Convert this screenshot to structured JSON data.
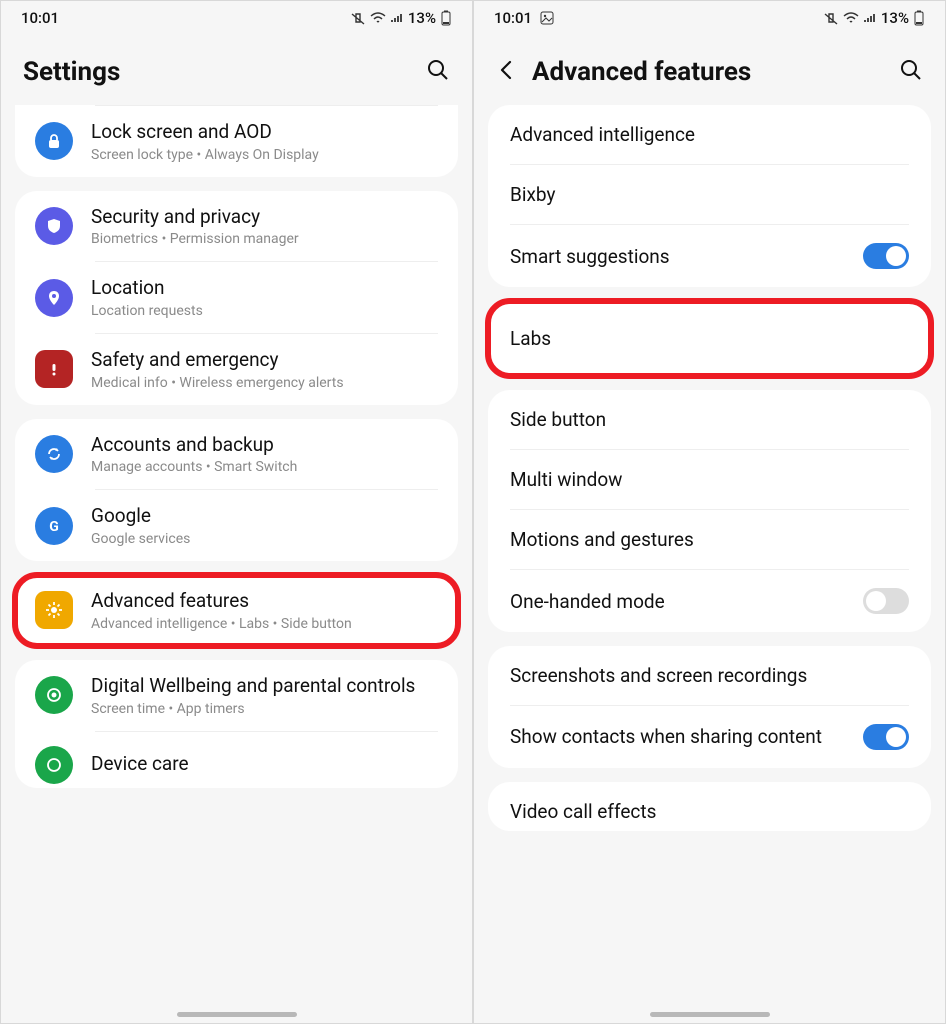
{
  "status": {
    "time": "10:01",
    "battery": "13%",
    "time_right": "10:01"
  },
  "left": {
    "title": "Settings",
    "groups": [
      {
        "items": [
          {
            "title": "Lock screen and AOD",
            "sub": "Screen lock type  •  Always On Display",
            "icon": "lock",
            "iconBg": "#2a7de1"
          }
        ]
      },
      {
        "items": [
          {
            "title": "Security and privacy",
            "sub": "Biometrics  •  Permission manager",
            "icon": "shield",
            "iconBg": "#5b5be6"
          },
          {
            "title": "Location",
            "sub": "Location requests",
            "icon": "pin",
            "iconBg": "#5b5be6"
          },
          {
            "title": "Safety and emergency",
            "sub": "Medical info  •  Wireless emergency alerts",
            "icon": "alert",
            "iconBg": "#b42424"
          }
        ]
      },
      {
        "items": [
          {
            "title": "Accounts and backup",
            "sub": "Manage accounts  •  Smart Switch",
            "icon": "sync",
            "iconBg": "#2a7de1"
          },
          {
            "title": "Google",
            "sub": "Google services",
            "icon": "google",
            "iconBg": "#2a7de1"
          }
        ]
      },
      {
        "items": [
          {
            "title": "Advanced features",
            "sub": "Advanced intelligence  •  Labs  •  Side button",
            "icon": "gear",
            "iconBg": "#f0a800",
            "highlight": true
          }
        ]
      },
      {
        "items": [
          {
            "title": "Digital Wellbeing and parental controls",
            "sub": "Screen time  •  App timers",
            "icon": "wellbeing",
            "iconBg": "#1aa64a"
          },
          {
            "title": "Device care",
            "sub": "",
            "icon": "care",
            "iconBg": "#1aa64a"
          }
        ]
      }
    ]
  },
  "right": {
    "title": "Advanced features",
    "groups": [
      [
        {
          "label": "Advanced intelligence"
        },
        {
          "label": "Bixby"
        },
        {
          "label": "Smart suggestions",
          "toggle": "on"
        }
      ],
      [
        {
          "label": "Labs",
          "highlight": true
        }
      ],
      [
        {
          "label": "Side button"
        },
        {
          "label": "Multi window"
        },
        {
          "label": "Motions and gestures"
        },
        {
          "label": "One-handed mode",
          "toggle": "off"
        }
      ],
      [
        {
          "label": "Screenshots and screen recordings"
        },
        {
          "label": "Show contacts when sharing content",
          "toggle": "on"
        }
      ],
      [
        {
          "label": "Video call effects"
        }
      ]
    ]
  }
}
